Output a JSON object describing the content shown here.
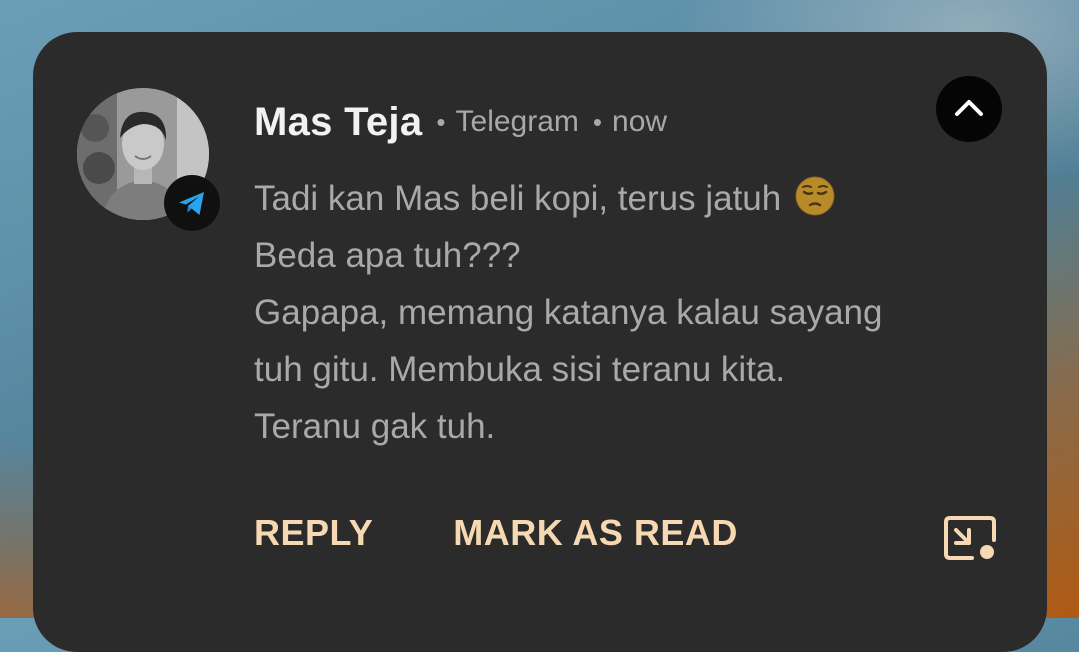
{
  "notification": {
    "sender": "Mas Teja",
    "app": "Telegram",
    "time": "now",
    "avatar_icon": "profile-photo",
    "app_icon": "telegram-plane-icon",
    "collapse_icon": "chevron-up-icon",
    "messages": [
      "Tadi kan Mas beli kopi, terus jatuh",
      "Beda apa tuh???",
      "Gapapa, memang katanya kalau sayang",
      "tuh gitu. Membuka sisi teranu kita.",
      "Teranu gak tuh."
    ],
    "emoji": "😔",
    "actions": {
      "reply": "REPLY",
      "mark_read": "MARK AS READ"
    },
    "popout_icon": "open-in-popup-icon"
  },
  "colors": {
    "card": "#2b2b2b",
    "accent": "#f6d9b3",
    "telegram_blue": "#2aa3ef"
  }
}
